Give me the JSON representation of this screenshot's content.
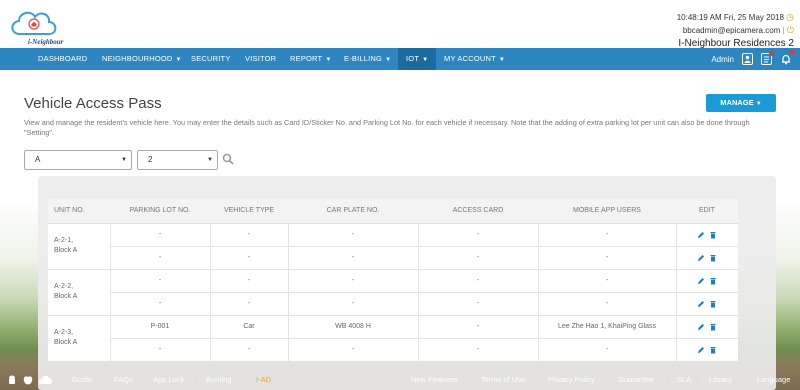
{
  "header": {
    "logo_text": "i-Neighbour",
    "datetime": "10:48:19 AM  Fri, 25 May 2018",
    "account": "bbcadmin@epicamera.com",
    "estate": "I-Neighbour Residences 2"
  },
  "nav": {
    "items": [
      {
        "label": "DASHBOARD",
        "caret": false
      },
      {
        "label": "NEIGHBOURHOOD",
        "caret": true
      },
      {
        "label": "SECURITY",
        "caret": false
      },
      {
        "label": "VISITOR",
        "caret": false
      },
      {
        "label": "REPORT",
        "caret": true
      },
      {
        "label": "E-BILLING",
        "caret": true
      },
      {
        "label": "IOT",
        "caret": true,
        "active": true
      },
      {
        "label": "MY ACCOUNT",
        "caret": true
      }
    ],
    "user": "Admin"
  },
  "page": {
    "title": "Vehicle Access Pass",
    "manage_label": "MANAGE",
    "description": "View and manage the resident's vehicle here. You may enter the details such as Card ID/Sticker No. and Parking Lot No. for each vehicle if necessary. Note that the adding of extra parking lot per unit can also be done through \"Setting\"."
  },
  "filters": {
    "block": "A",
    "floor": "2"
  },
  "table": {
    "headers": [
      "UNIT NO.",
      "PARKING LOT NO.",
      "VEHICLE TYPE",
      "CAR PLATE NO.",
      "ACCESS CARD",
      "MOBILE APP USERS",
      "EDIT"
    ],
    "units": [
      {
        "unit": "A-2-1,",
        "block": "Block A",
        "rows": [
          [
            "-",
            "-",
            "-",
            "-",
            "-"
          ],
          [
            "-",
            "-",
            "-",
            "-",
            "-"
          ]
        ]
      },
      {
        "unit": "A-2-2,",
        "block": "Block A",
        "rows": [
          [
            "-",
            "-",
            "-",
            "-",
            "-"
          ],
          [
            "-",
            "-",
            "-",
            "-",
            "-"
          ]
        ]
      },
      {
        "unit": "A-2-3,",
        "block": "Block A",
        "rows": [
          [
            "P-001",
            "Car",
            "WB 4008 H",
            "-",
            "Lee Zhe Hao 1, KhaiPing Glass"
          ],
          [
            "-",
            "-",
            "-",
            "-",
            "-"
          ]
        ]
      }
    ]
  },
  "footer": {
    "left_links": [
      "Guide",
      "FAQs",
      "App Lock",
      "Bunting",
      "I-AD"
    ],
    "right_links": [
      "New Features",
      "Terms of Use",
      "Privacy Policy",
      "Guarantee",
      "SLA",
      "Library",
      "Language"
    ]
  },
  "colors": {
    "nav_bg": "#2e86c1",
    "nav_active": "#1b6aa0",
    "manage_btn": "#1a9bd7",
    "accent_icon": "#1a7fc4",
    "footer_highlight": "#f5a623"
  }
}
